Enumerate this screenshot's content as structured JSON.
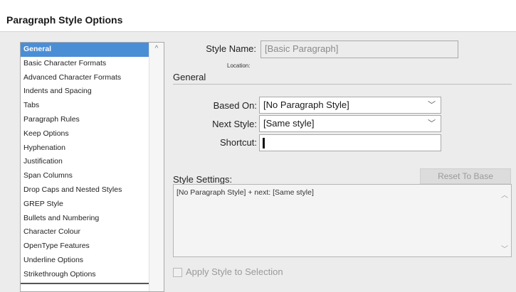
{
  "window": {
    "title": "Paragraph Style Options"
  },
  "sidebar": {
    "items": [
      {
        "label": "General",
        "selected": true
      },
      {
        "label": "Basic Character Formats"
      },
      {
        "label": "Advanced Character Formats"
      },
      {
        "label": "Indents and Spacing"
      },
      {
        "label": "Tabs"
      },
      {
        "label": "Paragraph Rules"
      },
      {
        "label": "Keep Options"
      },
      {
        "label": "Hyphenation"
      },
      {
        "label": "Justification"
      },
      {
        "label": "Span Columns"
      },
      {
        "label": "Drop Caps and Nested Styles"
      },
      {
        "label": "GREP Style"
      },
      {
        "label": "Bullets and Numbering"
      },
      {
        "label": "Character Colour"
      },
      {
        "label": "OpenType Features"
      },
      {
        "label": "Underline Options"
      },
      {
        "label": "Strikethrough Options"
      }
    ],
    "scroll_up_glyph": "^"
  },
  "form": {
    "style_name_label": "Style Name:",
    "style_name_value": "[Basic Paragraph]",
    "location_label": "Location:",
    "general_section": "General",
    "based_on_label": "Based On:",
    "based_on_value": "[No Paragraph Style]",
    "next_style_label": "Next Style:",
    "next_style_value": "[Same style]",
    "shortcut_label": "Shortcut:",
    "shortcut_value": "",
    "style_settings_label": "Style Settings:",
    "reset_button": "Reset To Base",
    "style_settings_text": "[No Paragraph Style] + next: [Same style]",
    "apply_label": "Apply Style to Selection",
    "apply_checked": false
  },
  "colors": {
    "selection": "#4a8ed6",
    "dialog_bg": "#ececec"
  },
  "icons": {
    "dropdown": "chevron-down-icon",
    "scroll_up": "scroll-up-icon",
    "scroll_down": "scroll-down-icon"
  }
}
